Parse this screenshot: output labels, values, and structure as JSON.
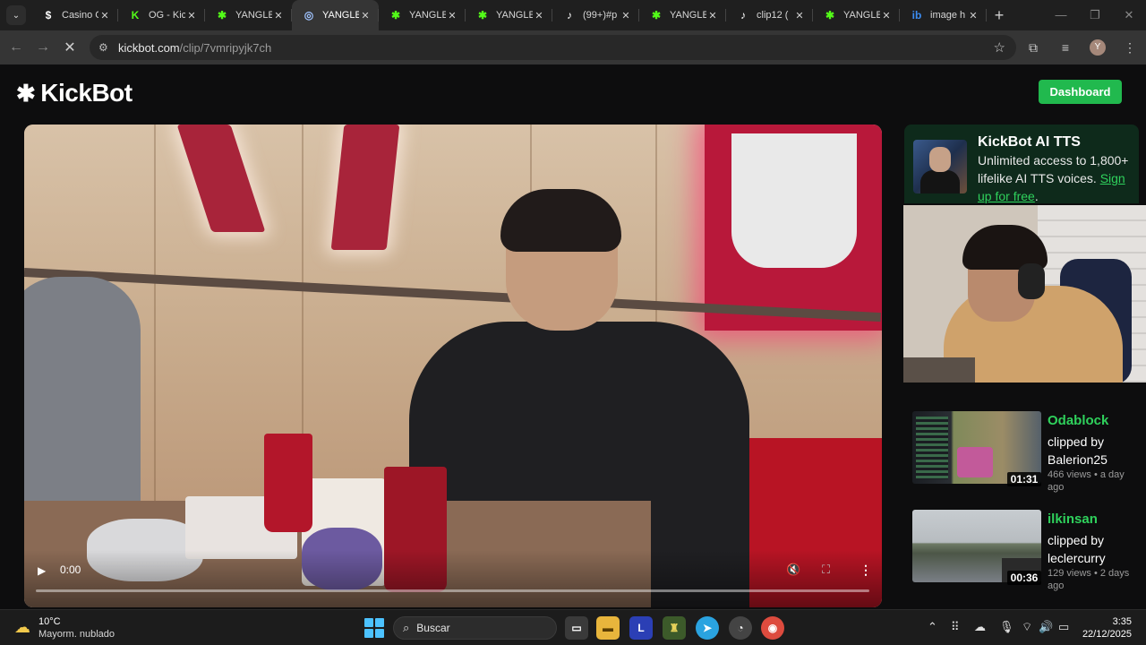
{
  "browser": {
    "tabs": [
      {
        "title": "Casino C",
        "icon": "dollar-icon",
        "color": "#ffffff"
      },
      {
        "title": "OG - Kic",
        "icon": "kick-k-icon",
        "color": "#53fc18"
      },
      {
        "title": "YANGLE",
        "icon": "kickbot-icon",
        "color": "#53fc18"
      },
      {
        "title": "YANGLE",
        "icon": "loading-icon",
        "color": "#a0c4ff",
        "active": true
      },
      {
        "title": "YANGLE",
        "icon": "kickbot-icon",
        "color": "#53fc18"
      },
      {
        "title": "YANGLE",
        "icon": "kickbot-icon",
        "color": "#53fc18"
      },
      {
        "title": "(99+)#p",
        "icon": "tiktok-icon",
        "color": "#ffffff"
      },
      {
        "title": "YANGLE",
        "icon": "kickbot-icon",
        "color": "#53fc18"
      },
      {
        "title": "clip12 (",
        "icon": "tiktok-icon",
        "color": "#ffffff"
      },
      {
        "title": "YANGLE",
        "icon": "kickbot-icon",
        "color": "#53fc18"
      },
      {
        "title": "image h",
        "icon": "imgbb-icon",
        "color": "#3b8cf0"
      }
    ],
    "url_domain": "kickbot.com",
    "url_path": "/clip/7vmripyjk7ch",
    "profile_initial": "Y"
  },
  "site": {
    "logo_text": "KickBot",
    "dashboard_label": "Dashboard",
    "accent": "#21b94e"
  },
  "video": {
    "time": "0:00"
  },
  "ad": {
    "title": "KickBot AI TTS",
    "text": "Unlimited access to 1,800+ lifelike AI TTS voices. ",
    "link": "Sign up for free",
    "after": "."
  },
  "clips": [
    {
      "channel": "Odablock",
      "clipped_by": "clipped by Balerion25",
      "meta": "466 views • a day ago",
      "duration": "01:31"
    },
    {
      "channel": "ilkinsan",
      "clipped_by": "clipped by leclercurry",
      "meta": "129 views • 2 days ago",
      "duration": "00:36"
    }
  ],
  "taskbar": {
    "temp": "10°C",
    "weather": "Mayorm. nublado",
    "search_placeholder": "Buscar",
    "time": "3:35",
    "date": "22/12/2025"
  }
}
